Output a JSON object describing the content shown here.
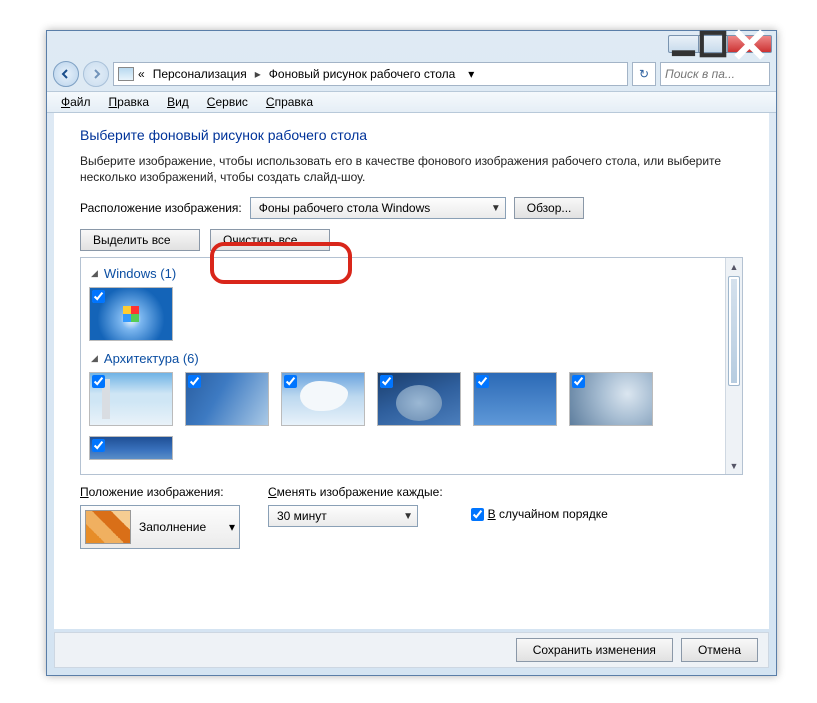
{
  "window": {
    "breadcrumb1": "Персонализация",
    "breadcrumb2": "Фоновый рисунок рабочего стола",
    "search_placeholder": "Поиск в па..."
  },
  "menu": {
    "file_u": "Ф",
    "file_rest": "айл",
    "edit_u": "П",
    "edit_rest": "равка",
    "view_u": "В",
    "view_rest": "ид",
    "tools_u": "С",
    "tools_rest": "ервис",
    "help_u": "С",
    "help_rest": "правка"
  },
  "heading": "Выберите фоновый рисунок рабочего стола",
  "subtext": "Выберите изображение, чтобы использовать его в качестве фонового изображения рабочего стола, или выберите несколько изображений, чтобы создать слайд-шоу.",
  "loc_label": "Расположение изображения:",
  "loc_value": "Фоны рабочего стола Windows",
  "browse": "Обзор...",
  "select_all": "Выделить все",
  "clear_all": "Очистить все",
  "group1": "Windows (1)",
  "group2": "Архитектура (6)",
  "pos_label_u": "П",
  "pos_label_rest": "оложение изображения:",
  "pos_value": "Заполнение",
  "int_label_u": "С",
  "int_label_rest": "менять изображение каждые:",
  "int_value": "30 минут",
  "shuffle_u": "В",
  "shuffle_rest": " случайном порядке",
  "save": "Сохранить изменения",
  "cancel": "Отмена"
}
